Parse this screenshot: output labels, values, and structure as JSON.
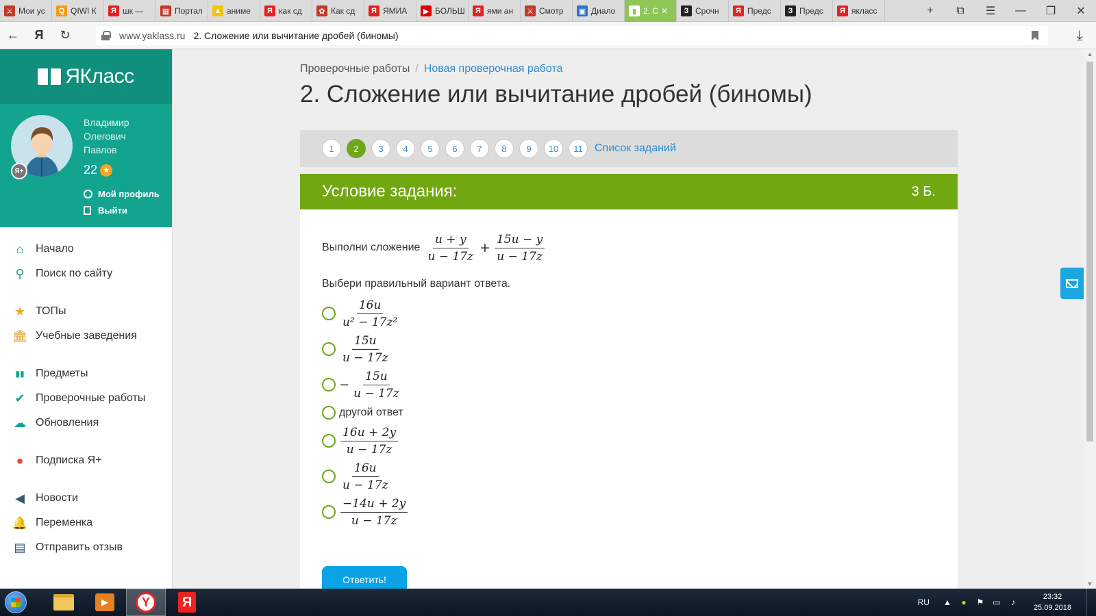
{
  "browser": {
    "tabs": [
      {
        "label": "Мои ус",
        "icon_color": "#c0392b",
        "icon_char": "⚔"
      },
      {
        "label": "QIWI К",
        "icon_color": "#f39c12",
        "icon_char": "Q"
      },
      {
        "label": "шк — ",
        "icon_color": "#e22222",
        "icon_char": "Я"
      },
      {
        "label": "Портал",
        "icon_color": "#c0392b",
        "icon_char": "▦"
      },
      {
        "label": "аниме",
        "icon_color": "#f1c40f",
        "icon_char": "▲"
      },
      {
        "label": "как сд",
        "icon_color": "#e22222",
        "icon_char": "Я"
      },
      {
        "label": "Как сд",
        "icon_color": "#c0392b",
        "icon_char": "✿"
      },
      {
        "label": "ЯМИА",
        "icon_color": "#e22222",
        "icon_char": "Я"
      },
      {
        "label": "БОЛЬШ",
        "icon_color": "#e00000",
        "icon_char": "▶"
      },
      {
        "label": "ями ан",
        "icon_color": "#e22222",
        "icon_char": "Я"
      },
      {
        "label": "Смотр",
        "icon_color": "#c0392b",
        "icon_char": "⚔"
      },
      {
        "label": "Диало",
        "icon_color": "#2e72c9",
        "icon_char": "▣"
      },
      {
        "label": "2. С",
        "icon_color": "#ffffff",
        "icon_char": "▮",
        "active": true
      },
      {
        "label": "Срочн",
        "icon_color": "#222222",
        "icon_char": "З"
      },
      {
        "label": "Предс",
        "icon_color": "#e22222",
        "icon_char": "Я"
      },
      {
        "label": "Предс",
        "icon_color": "#222222",
        "icon_char": "З"
      },
      {
        "label": "якласс",
        "icon_color": "#e22222",
        "icon_char": "Я"
      }
    ],
    "url_domain": "www.yaklass.ru",
    "url_title": "2. Сложение или вычитание дробей (биномы)"
  },
  "sidebar": {
    "logo_text": "ЯКласс",
    "user_name": "Владимир Олегович Павлов",
    "points": "22",
    "profile_link": "Мой профиль",
    "logout_link": "Выйти",
    "menu_groups": [
      [
        {
          "label": "Начало",
          "icon": "home-icon"
        },
        {
          "label": "Поиск по сайту",
          "icon": "search-icon"
        }
      ],
      [
        {
          "label": "ТОПы",
          "icon": "star-icon"
        },
        {
          "label": "Учебные заведения",
          "icon": "institution-icon"
        }
      ],
      [
        {
          "label": "Предметы",
          "icon": "books-icon"
        },
        {
          "label": "Проверочные работы",
          "icon": "check-circle-icon"
        },
        {
          "label": "Обновления",
          "icon": "cloud-update-icon"
        }
      ],
      [
        {
          "label": "Подписка Я+",
          "icon": "ya-plus-icon"
        }
      ],
      [
        {
          "label": "Новости",
          "icon": "megaphone-icon"
        },
        {
          "label": "Переменка",
          "icon": "bell-icon"
        },
        {
          "label": "Отправить отзыв",
          "icon": "feedback-icon"
        }
      ]
    ]
  },
  "main": {
    "breadcrumb": {
      "root": "Проверочные работы",
      "current": "Новая проверочная работа"
    },
    "title": "2. Сложение или вычитание дробей (биномы)",
    "task_numbers": [
      "1",
      "2",
      "3",
      "4",
      "5",
      "6",
      "7",
      "8",
      "9",
      "10",
      "11"
    ],
    "current_task": "2",
    "task_list_link": "Список заданий",
    "condition_title": "Условие задания:",
    "condition_points": "3 Б.",
    "task_prefix": "Выполни сложение",
    "task_expr": {
      "f1_num": "u + y",
      "f1_den": "u − 17z",
      "op": "+",
      "f2_num": "15u − y",
      "f2_den": "u − 17z"
    },
    "instruction": "Выбери правильный вариант ответа.",
    "options": [
      {
        "type": "frac",
        "num": "16u",
        "den_html": "u² − 17z²"
      },
      {
        "type": "frac",
        "num": "15u",
        "den_html": "u − 17z"
      },
      {
        "type": "negfrac",
        "num": "15u",
        "den_html": "u − 17z"
      },
      {
        "type": "text",
        "text": "другой ответ"
      },
      {
        "type": "frac",
        "num": "16u + 2y",
        "den_html": "u − 17z"
      },
      {
        "type": "frac",
        "num": "16u",
        "den_html": "u − 17z"
      },
      {
        "type": "frac",
        "num": "−14u + 2y",
        "den_html": "u − 17z"
      }
    ],
    "submit_label": "Ответить!"
  },
  "taskbar": {
    "lang": "RU",
    "time": "23:32",
    "date": "25.09.2018"
  },
  "colors": {
    "brand_teal": "#0f8f7c",
    "condition_green": "#71a812",
    "link_blue": "#2a8cce",
    "submit_blue": "#0aa4e6"
  }
}
